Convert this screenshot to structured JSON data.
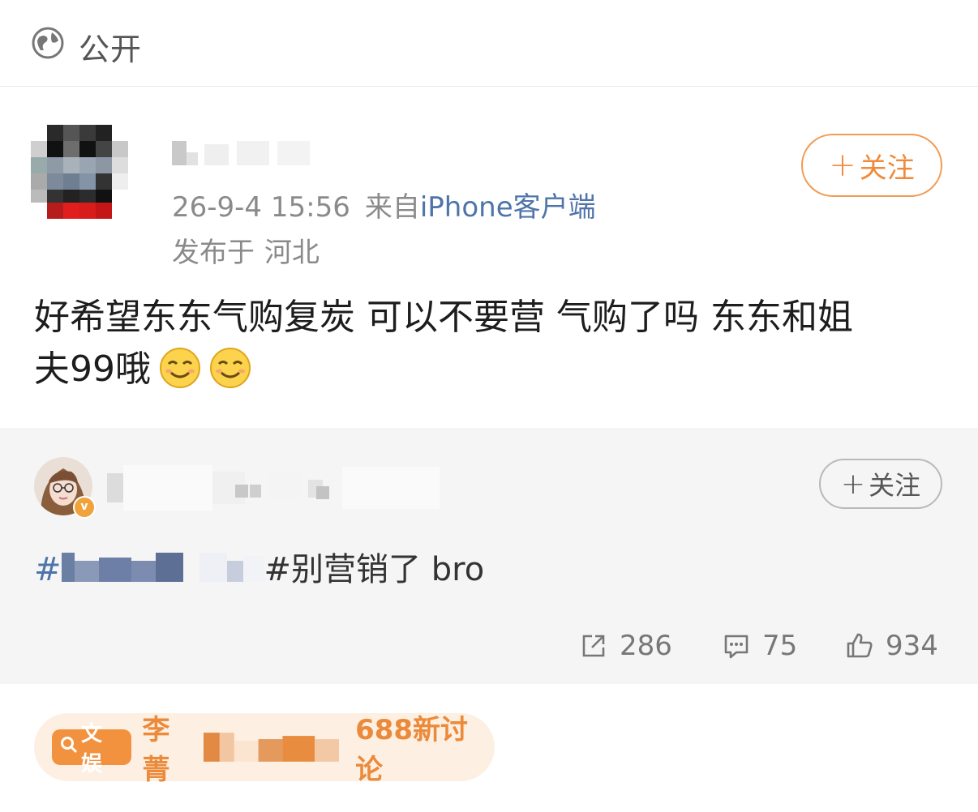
{
  "header": {
    "visibility_label": "公开",
    "visibility_icon": "globe-icon"
  },
  "post": {
    "time": "26-9-4 15:56",
    "from_prefix": "来自",
    "source": "iPhone客户端",
    "location_prefix": "发布于",
    "location": "河北",
    "follow_label": "关注",
    "text_line1": "好希望东东气购复炭 可以不要营 气购了吗 东东和姐",
    "text_line2": "夫99哦",
    "emojis": [
      "smile-emoji",
      "smile-emoji"
    ]
  },
  "repost": {
    "follow_label": "关注",
    "hashtag_prefix": "#",
    "hashtag_text": "#别营销了 bro",
    "actions": {
      "share_count": "286",
      "comment_count": "75",
      "like_count": "934"
    }
  },
  "topic": {
    "badge_label": "文娱",
    "name_prefix": "李菁",
    "count_label": "688新讨论"
  },
  "colors": {
    "accent_orange": "#f08a3a",
    "link_blue": "#4f74a9"
  }
}
